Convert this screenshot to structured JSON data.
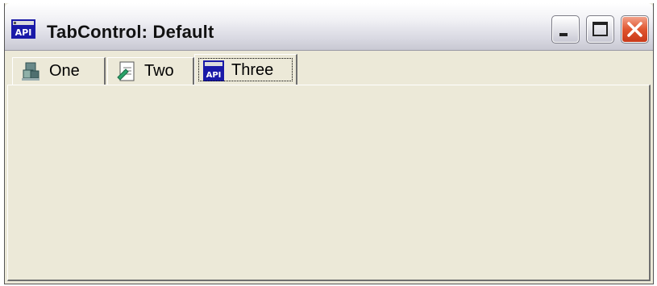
{
  "window": {
    "title": "TabControl: Default",
    "app_icon": "api-icon",
    "controls": {
      "minimize": "minimize-icon",
      "maximize": "maximize-icon",
      "close": "close-icon"
    },
    "colors": {
      "close_button": "#e0552f",
      "face": "#ece9d8"
    }
  },
  "tabs": [
    {
      "label": "One",
      "icon": "network-icon"
    },
    {
      "label": "Two",
      "icon": "document-icon"
    },
    {
      "label": "Three",
      "icon": "api-icon"
    }
  ],
  "selected_tab": "Three"
}
